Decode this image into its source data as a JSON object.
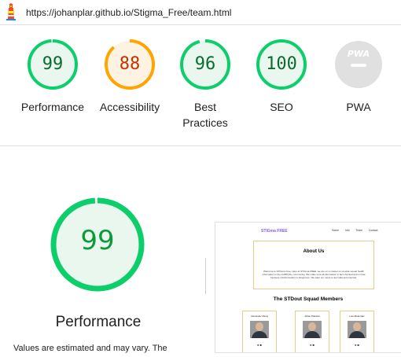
{
  "header": {
    "url": "https://johanplar.github.io/Stigma_Free/team.html",
    "logo_icon": "lighthouse-icon"
  },
  "gauges": [
    {
      "id": "performance",
      "score": "99",
      "label_lines": [
        "Performance"
      ],
      "fraction": 0.99,
      "color": "#0cce6b",
      "text_color": "#0c6b2f",
      "bg": "#eaf7ee"
    },
    {
      "id": "accessibility",
      "score": "88",
      "label_lines": [
        "Accessibility"
      ],
      "fraction": 0.88,
      "color": "#ffa400",
      "text_color": "#c33300",
      "bg": "#fdf3e3"
    },
    {
      "id": "best-practices",
      "score": "96",
      "label_lines": [
        "Best",
        "Practices"
      ],
      "fraction": 0.96,
      "color": "#0cce6b",
      "text_color": "#0c6b2f",
      "bg": "#eaf7ee"
    },
    {
      "id": "seo",
      "score": "100",
      "label_lines": [
        "SEO"
      ],
      "fraction": 1.0,
      "color": "#0cce6b",
      "text_color": "#0c6b2f",
      "bg": "#eaf7ee"
    },
    {
      "id": "pwa",
      "badge": "PWA",
      "label_lines": [
        "PWA"
      ],
      "fraction": 0,
      "color": "#cccccc",
      "bg": "#e0e0e0"
    }
  ],
  "performance_detail": {
    "score": "99",
    "fraction": 0.99,
    "label": "Performance",
    "note": "Values are estimated and may vary. The"
  },
  "screenshot": {
    "brand": "STIGma FREE",
    "nav": [
      "Home",
      "Info",
      "Team",
      "Contact"
    ],
    "about_title": "About Us",
    "about_text": "Welcome to STIGma Free. Here at STIGma FREE, we are on a mission to provide sexual health information to the LGBTQIA+ community. We make sure all information is fact checked and on that because misinformation is dangerous. We want our users to feel safe and inspired.",
    "team_title": "The STDout Squad Members",
    "members": [
      "Alexander Meng",
      "Johan Planken",
      "Luis Melendez"
    ]
  },
  "colors": {
    "pass": "#0cce6b",
    "average": "#ffa400",
    "na": "#e0e0e0"
  }
}
